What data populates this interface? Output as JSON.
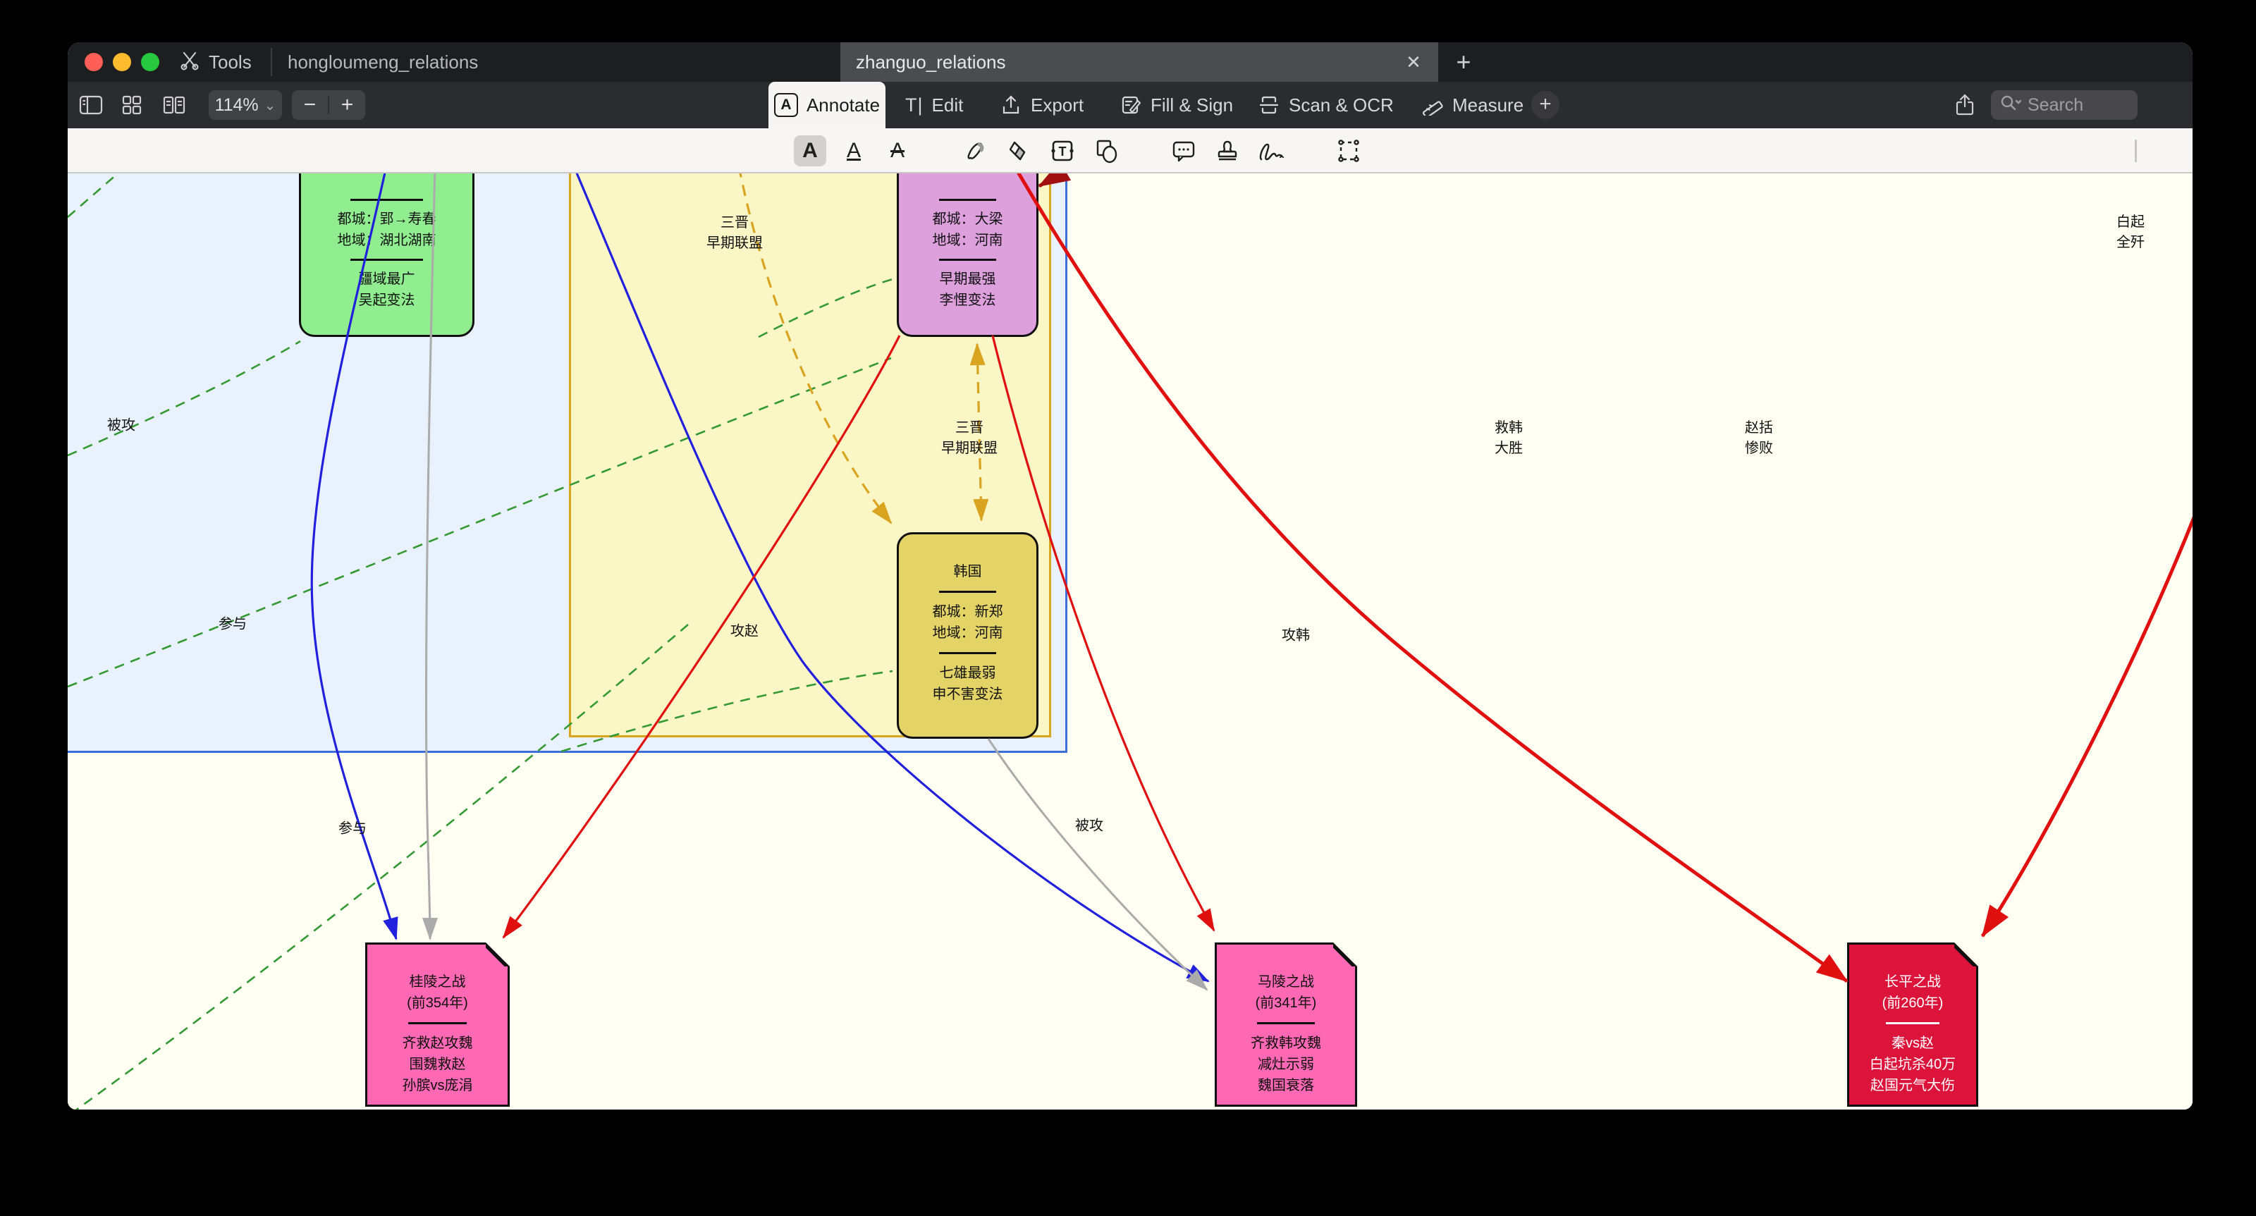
{
  "chrome": {
    "tools_label": "Tools",
    "tabs": [
      {
        "label": "hongloumeng_relations",
        "active": false
      },
      {
        "label": "zhanguo_relations",
        "active": true
      }
    ],
    "close_glyph": "✕",
    "new_tab_glyph": "+",
    "zoom_value": "114%",
    "chevron_glyph": "⌄",
    "minus_glyph": "−",
    "plus_glyph": "+",
    "mode_tabs": [
      "Annotate",
      "Edit",
      "Export",
      "Fill & Sign",
      "Scan & OCR",
      "Measure"
    ],
    "add_mode_glyph": "+",
    "search_placeholder": "Search",
    "annotate_glyphs": {
      "letter": "A",
      "textbox_letter": "T",
      "edit_letter": "T|"
    }
  },
  "diagram": {
    "colors": {
      "chu_fill": "#90EE90",
      "wei_fill": "#DDA0DD",
      "han_fill": "#E4D468",
      "battle_pink": "#FF69B4",
      "battle_crimson": "#DC143C",
      "cluster_blue": "#E9F2FC",
      "cluster_blue_border": "#3D6EDA",
      "cluster_yellow": "#FBF6C5",
      "cluster_yellow_border": "#D9A420",
      "edge_green": "#339933",
      "edge_blue": "#2020DD",
      "edge_gray": "#ABABAB",
      "edge_gold": "#D9A420",
      "edge_red": "#E01010",
      "edge_maroon": "#A01010"
    },
    "nodes": {
      "chu": {
        "rows": [
          "都城：郢→寿春",
          "地域：湖北湖南"
        ],
        "notes": [
          "疆域最广",
          "吴起变法"
        ]
      },
      "wei": {
        "rows": [
          "都城：大梁",
          "地域：河南"
        ],
        "notes": [
          "早期最强",
          "李悝变法"
        ]
      },
      "han": {
        "title": "韩国",
        "rows": [
          "都城：新郑",
          "地域：河南"
        ],
        "notes": [
          "七雄最弱",
          "申不害变法"
        ]
      },
      "guiling": {
        "title": "桂陵之战",
        "year": "(前354年)",
        "notes": [
          "齐救赵攻魏",
          "围魏救赵",
          "孙膑vs庞涓"
        ]
      },
      "maling": {
        "title": "马陵之战",
        "year": "(前341年)",
        "notes": [
          "齐救韩攻魏",
          "减灶示弱",
          "魏国衰落"
        ]
      },
      "changping": {
        "title": "长平之战",
        "year": "(前260年)",
        "notes": [
          "秦vs赵",
          "白起坑杀40万",
          "赵国元气大伤"
        ]
      }
    },
    "labels": {
      "beigong_top": "被攻",
      "canyu_top": "参与",
      "sanjin_1": "三晋\n早期联盟",
      "sanjin_2": "三晋\n早期联盟",
      "gongzhao": "攻赵",
      "gonghan": "攻韩",
      "jiuhan": "救韩\n大胜",
      "zhaokuo": "赵括\n惨败",
      "baiqi": "白起\n全歼",
      "canyu_bottom": "参与",
      "beigong_bottom": "被攻"
    }
  }
}
